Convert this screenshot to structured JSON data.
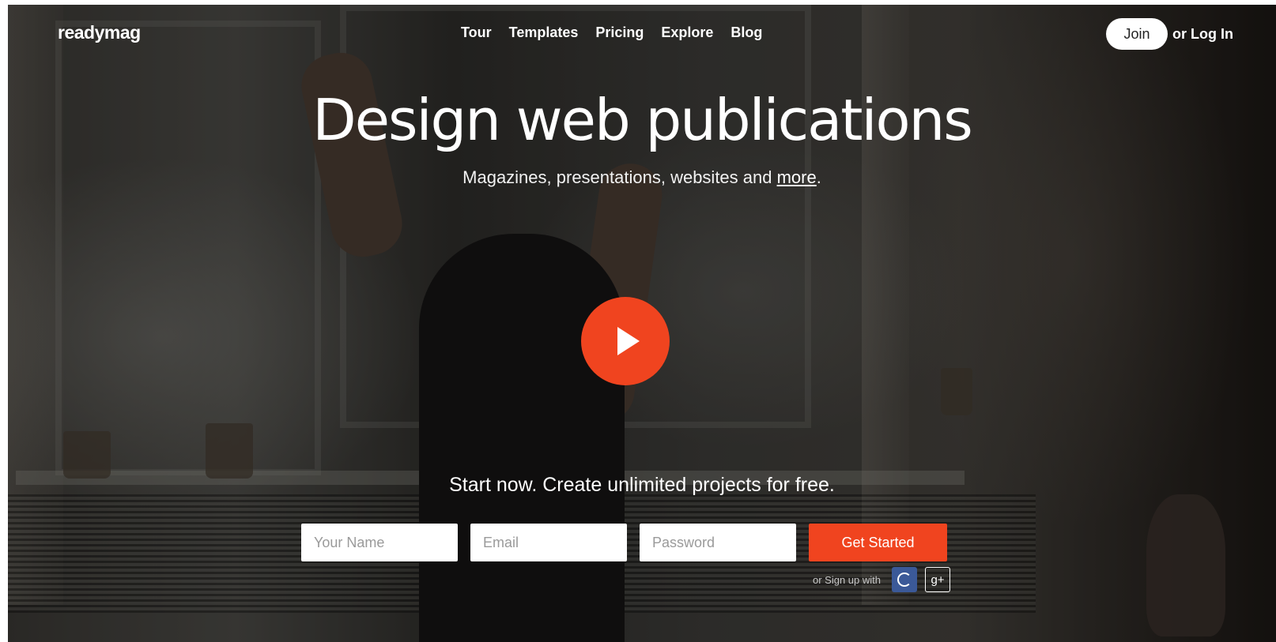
{
  "brand": {
    "logo": "readymag"
  },
  "nav": {
    "items": [
      "Tour",
      "Templates",
      "Pricing",
      "Explore",
      "Blog"
    ]
  },
  "auth": {
    "join_label": "Join",
    "login_label": "or Log In"
  },
  "hero": {
    "headline": "Design web publications",
    "subline_text": "Magazines, presentations, websites and ",
    "subline_link": "more",
    "subline_end": ".",
    "cta": "Start now. Create unlimited projects for free."
  },
  "form": {
    "name_placeholder": "Your Name",
    "email_placeholder": "Email",
    "password_placeholder": "Password",
    "submit_label": "Get Started",
    "social_label": "or Sign up with",
    "gplus_label": "g+"
  },
  "colors": {
    "accent": "#f0441f",
    "facebook": "#3b5998"
  },
  "icons": {
    "play": "play-icon",
    "facebook": "spinner-icon",
    "gplus": "google-plus-icon"
  }
}
